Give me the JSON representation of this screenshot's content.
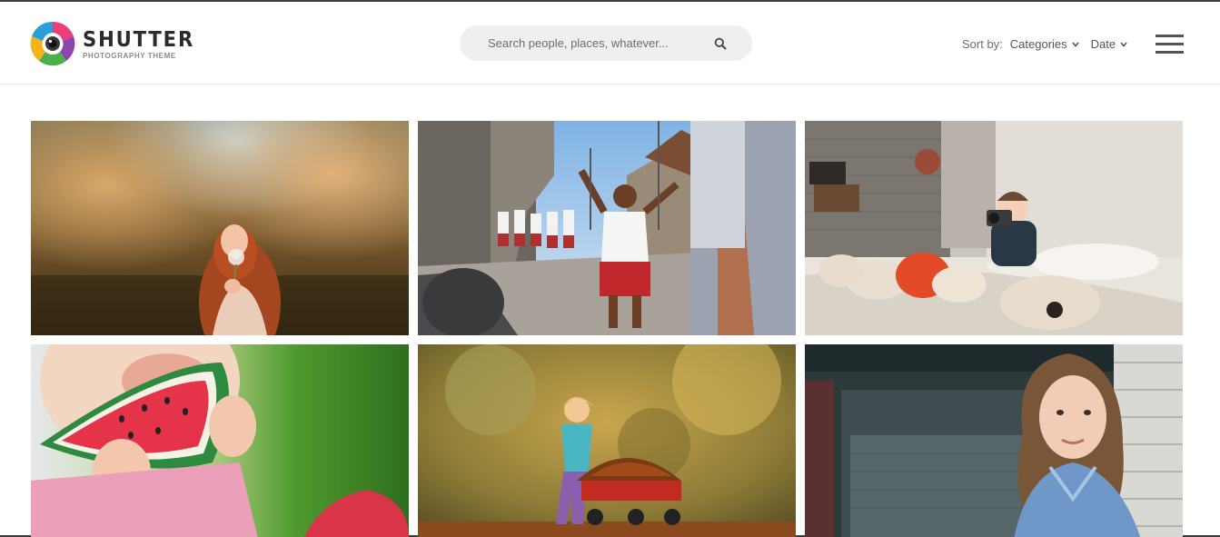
{
  "brand": {
    "title": "SHUTTER",
    "subtitle": "PHOTOGRAPHY THEME",
    "colors": [
      "#e8407a",
      "#2a9fd8",
      "#f6b21a",
      "#4bb04a",
      "#8e44ad"
    ]
  },
  "search": {
    "placeholder": "Search people, places, whatever...",
    "icon": "search-icon"
  },
  "sort": {
    "label": "Sort by:",
    "categories_label": "Categories",
    "date_label": "Date"
  },
  "menu": {
    "icon": "hamburger-menu-icon"
  },
  "gallery": {
    "photos": [
      {
        "subject": "girl-with-flower"
      },
      {
        "subject": "schoolchildren-running"
      },
      {
        "subject": "toddler-with-camera"
      },
      {
        "subject": "girl-eating-watermelon"
      },
      {
        "subject": "child-with-leaf-wagon"
      },
      {
        "subject": "girl-in-denim-jacket"
      }
    ]
  }
}
